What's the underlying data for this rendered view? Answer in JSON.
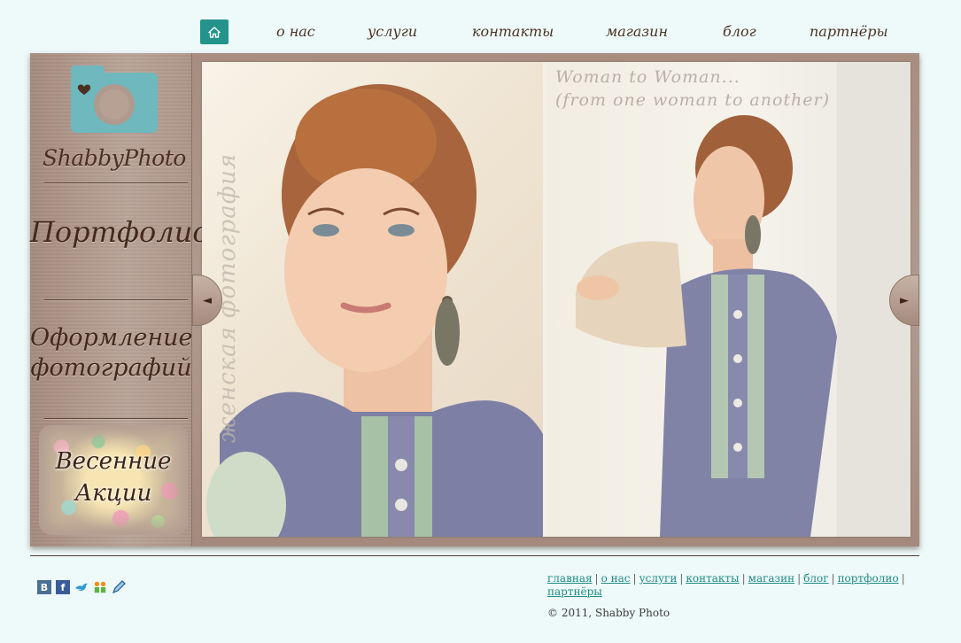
{
  "nav": {
    "home_icon": "home-icon",
    "items": [
      "о нас",
      "услуги",
      "контакты",
      "магазин",
      "блог",
      "партнёры"
    ]
  },
  "sidebar": {
    "logo_text": "ShabbyPhoto",
    "logo_icon": "camera-heart-icon",
    "links": [
      "Портфолио",
      "Оформление",
      "фотографий"
    ],
    "promo": [
      "Весенние",
      "Акции"
    ]
  },
  "slide": {
    "vertical_caption": "женская фотография",
    "caption_line1": "Woman to Woman...",
    "caption_line2": "(from one woman to another)",
    "prev_icon": "◄",
    "next_icon": "►"
  },
  "footer": {
    "social_icons": [
      "vkontakte-icon",
      "facebook-icon",
      "twitter-icon",
      "odnoklassniki-icon",
      "livejournal-icon"
    ],
    "social_glyphs": [
      "В",
      "f",
      "",
      "",
      ""
    ],
    "links": [
      "главная",
      "о нас",
      "услуги",
      "контакты",
      "магазин",
      "блог",
      "портфолио",
      "партнёры"
    ],
    "copyright": "© 2011, Shabby Photo"
  },
  "colors": {
    "background": "#eefaf9",
    "accent": "#24938c",
    "frame": "#a88d80",
    "nav_text": "#4a3327",
    "link": "#1e8a84"
  }
}
